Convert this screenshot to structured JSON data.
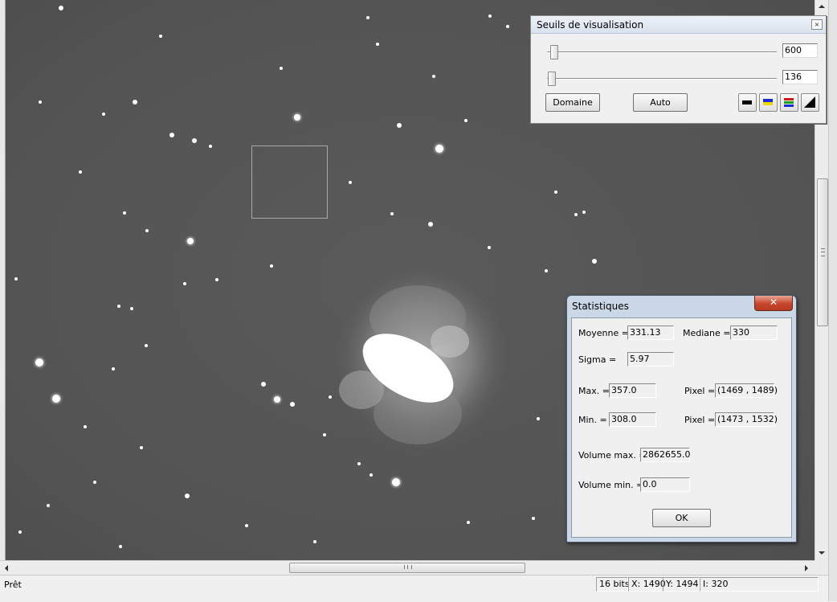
{
  "status_bar": {
    "text": "Prêt",
    "bits": "16 bits",
    "x": "X: 1490",
    "y": "Y: 1494",
    "i": "I: 320"
  },
  "seuils": {
    "title": "Seuils de visualisation",
    "high_value": "600",
    "low_value": "136",
    "domain_button": "Domaine",
    "auto_button": "Auto",
    "palette_icons": [
      "palette-gray-icon",
      "palette-blue-yellow-icon",
      "palette-rgb-icon",
      "palette-ramp-icon"
    ]
  },
  "stats": {
    "title": "Statistiques",
    "moyenne_label": "Moyenne =",
    "moyenne": "331.13",
    "mediane_label": "Mediane =",
    "mediane": "330",
    "sigma_label": "Sigma =",
    "sigma": "5.97",
    "max_label": "Max. =",
    "max": "357.0",
    "pixel_max_label": "Pixel =",
    "pixel_max": "(1469 , 1489)",
    "min_label": "Min. =",
    "min": "308.0",
    "pixel_min_label": "Pixel =",
    "pixel_min": "(1473 , 1532)",
    "vol_max_label": "Volume max. =",
    "vol_max": "2862655.0",
    "vol_min_label": "Volume min. =",
    "vol_min": "0.0",
    "ok_button": "OK",
    "close_glyph": "✕"
  },
  "seuils_close_glyph": "×"
}
